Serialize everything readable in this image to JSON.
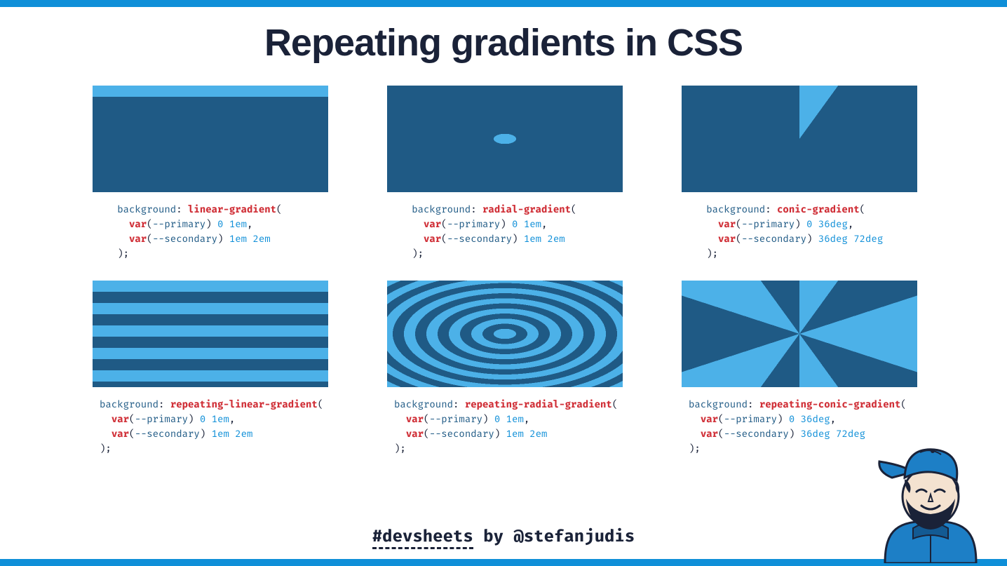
{
  "title": "Repeating gradients in CSS",
  "footer": {
    "tag": "#devsheets",
    "by": " by ",
    "handle": "@stefanjudis"
  },
  "code_tokens": {
    "background": "background",
    "var": "var",
    "primary": "--primary",
    "secondary": "--secondary"
  },
  "cells": [
    {
      "function": "linear-gradient",
      "stops": [
        {
          "var": "--primary",
          "a": "0",
          "b": "1em"
        },
        {
          "var": "--secondary",
          "a": "1em",
          "b": "2em"
        }
      ],
      "indent": "   "
    },
    {
      "function": "radial-gradient",
      "stops": [
        {
          "var": "--primary",
          "a": "0",
          "b": "1em"
        },
        {
          "var": "--secondary",
          "a": "1em",
          "b": "2em"
        }
      ],
      "indent": "   "
    },
    {
      "function": "conic-gradient",
      "stops": [
        {
          "var": "--primary",
          "a": "0",
          "b": "36deg"
        },
        {
          "var": "--secondary",
          "a": "36deg",
          "b": "72deg"
        }
      ],
      "indent": "   "
    },
    {
      "function": "repeating-linear-gradient",
      "stops": [
        {
          "var": "--primary",
          "a": "0",
          "b": "1em"
        },
        {
          "var": "--secondary",
          "a": "1em",
          "b": "2em"
        }
      ],
      "indent": ""
    },
    {
      "function": "repeating-radial-gradient",
      "stops": [
        {
          "var": "--primary",
          "a": "0",
          "b": "1em"
        },
        {
          "var": "--secondary",
          "a": "1em",
          "b": "2em"
        }
      ],
      "indent": ""
    },
    {
      "function": "repeating-conic-gradient",
      "stops": [
        {
          "var": "--primary",
          "a": "0",
          "b": "36deg"
        },
        {
          "var": "--secondary",
          "a": "36deg",
          "b": "72deg"
        }
      ],
      "indent": ""
    }
  ]
}
